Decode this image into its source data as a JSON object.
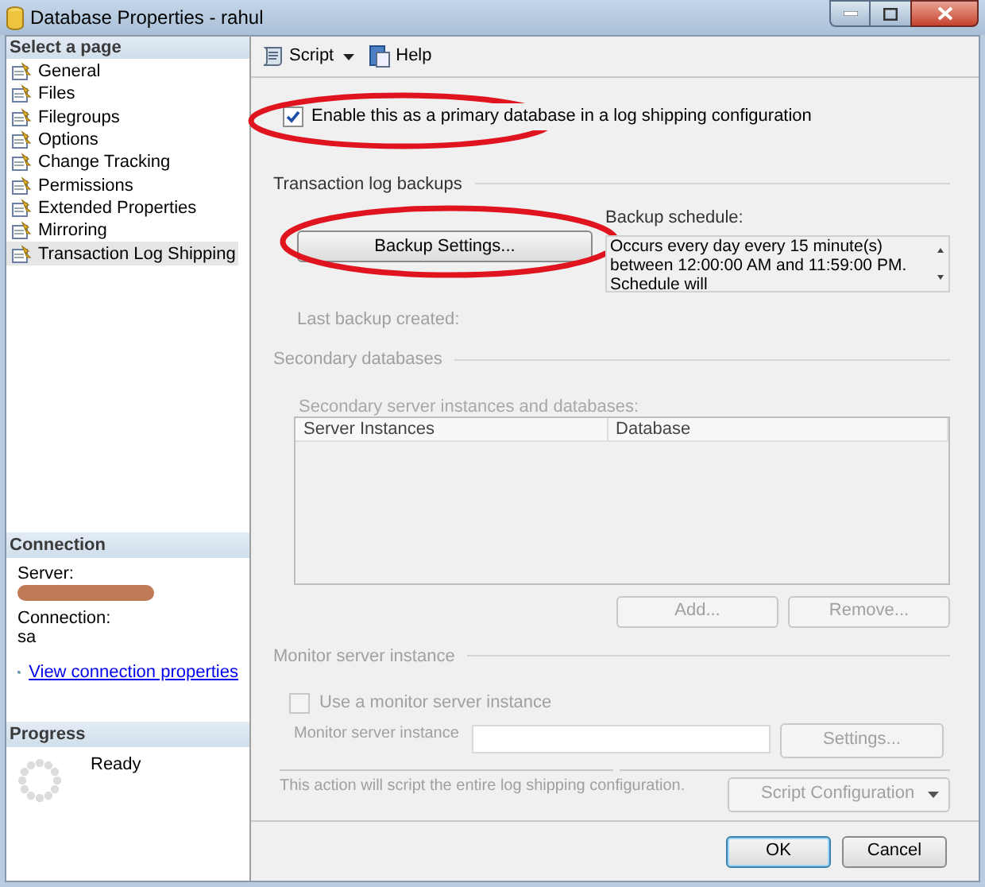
{
  "window": {
    "title": "Database Properties - rahul"
  },
  "sidebar": {
    "heading": "Select a page",
    "items": [
      {
        "label": "General",
        "selected": false
      },
      {
        "label": "Files",
        "selected": false
      },
      {
        "label": "Filegroups",
        "selected": false
      },
      {
        "label": "Options",
        "selected": false
      },
      {
        "label": "Change Tracking",
        "selected": false
      },
      {
        "label": "Permissions",
        "selected": false
      },
      {
        "label": "Extended Properties",
        "selected": false
      },
      {
        "label": "Mirroring",
        "selected": false
      },
      {
        "label": "Transaction Log Shipping",
        "selected": true
      }
    ]
  },
  "connection": {
    "heading": "Connection",
    "server_label": "Server:",
    "connection_label": "Connection:",
    "connection_value": "sa",
    "link": "View connection properties"
  },
  "progress": {
    "heading": "Progress",
    "status": "Ready"
  },
  "toolbar": {
    "script": "Script",
    "help": "Help"
  },
  "primary_checkbox": {
    "label": "Enable this as a primary database in a log shipping configuration",
    "checked": true
  },
  "log_backups": {
    "heading": "Transaction log backups",
    "settings_button": {
      "label": "Backup Settings...",
      "disabled": false
    },
    "schedule_label": "Backup schedule:",
    "schedule_text": "Occurs every day every 15 minute(s) between 12:00:00 AM and 11:59:00 PM. Schedule will",
    "last_backup": "Last backup created:"
  },
  "secondary": {
    "heading": "Secondary databases",
    "list_label": "Secondary server instances and databases:",
    "columns": [
      "Server Instances",
      "Database"
    ],
    "buttons": [
      {
        "label": "Add...",
        "disabled": true
      },
      {
        "label": "Remove...",
        "disabled": true
      }
    ]
  },
  "monitor": {
    "heading": "Monitor server instance",
    "checkbox": {
      "label": "Use a monitor server instance",
      "checked": false,
      "disabled": true
    },
    "field_label": "Monitor server instance",
    "settings_button": {
      "label": "Settings...",
      "disabled": true
    }
  },
  "script_note": "This action will script the entire log shipping configuration.",
  "script_button": {
    "label": "Script Configuration",
    "disabled": true
  },
  "footer_buttons": [
    {
      "label": "OK",
      "default": true
    },
    {
      "label": "Cancel",
      "default": false
    }
  ]
}
